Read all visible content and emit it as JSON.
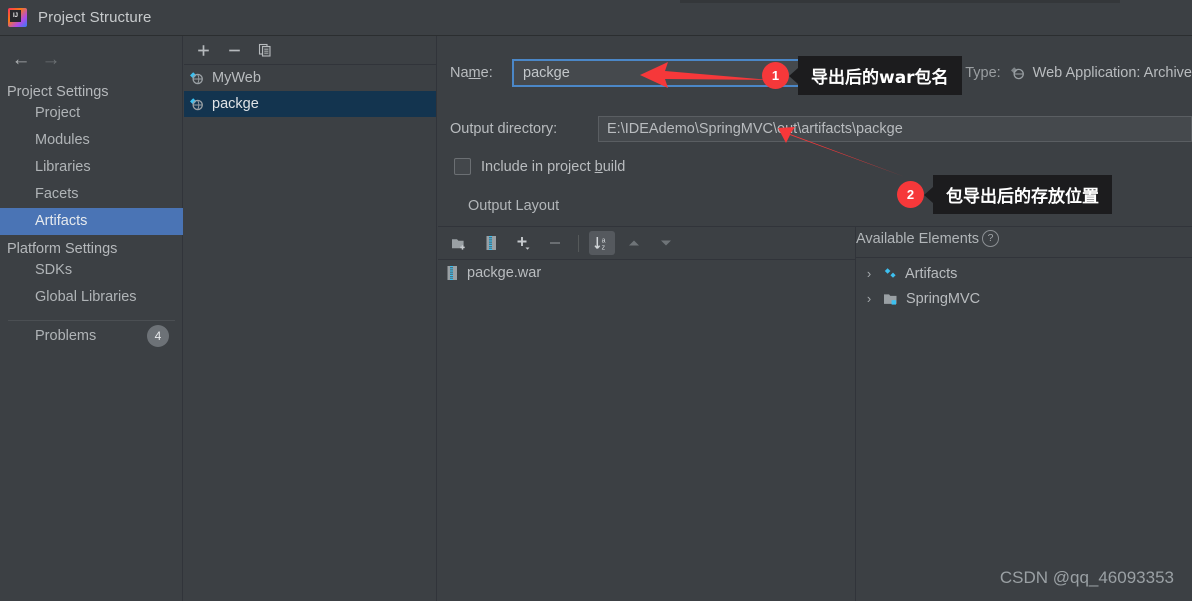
{
  "window": {
    "title": "Project Structure",
    "app_icon": "intellij-idea-logo"
  },
  "navigation": {
    "back_icon": "arrow-left-icon",
    "forward_icon": "arrow-right-icon"
  },
  "sidebar": {
    "groups": [
      {
        "label": "Project Settings",
        "items": [
          {
            "label": "Project",
            "selected": false
          },
          {
            "label": "Modules",
            "selected": false
          },
          {
            "label": "Libraries",
            "selected": false
          },
          {
            "label": "Facets",
            "selected": false
          },
          {
            "label": "Artifacts",
            "selected": true
          }
        ]
      },
      {
        "label": "Platform Settings",
        "items": [
          {
            "label": "SDKs",
            "selected": false
          },
          {
            "label": "Global Libraries",
            "selected": false
          }
        ]
      }
    ],
    "problems": {
      "label": "Problems",
      "count": "4"
    }
  },
  "artifacts_panel": {
    "toolbar": [
      {
        "name": "add-artifact-button",
        "glyph": "+"
      },
      {
        "name": "remove-artifact-button",
        "glyph": "−"
      },
      {
        "name": "copy-artifact-button",
        "glyph": "copy-icon"
      }
    ],
    "items": [
      {
        "label": "MyWeb",
        "selected": false,
        "icon": "artifact-icon"
      },
      {
        "label": "packge",
        "selected": true,
        "icon": "artifact-icon"
      }
    ]
  },
  "detail": {
    "name_label": "Name:",
    "name_label_prefix": "Na",
    "name_label_mnemonic": "m",
    "name_label_suffix": "e:",
    "name_value": "packge",
    "type_label": "Type:",
    "type_value": "Web Application: Archive",
    "output_directory_label": "Output directory:",
    "output_directory_value": "E:\\IDEAdemo\\SpringMVC\\out\\artifacts\\packge",
    "include_in_build": {
      "label_prefix": "Include in project ",
      "label_mnemonic": "b",
      "label_suffix": "uild",
      "checked": false
    },
    "output_layout_tab": "Output Layout"
  },
  "output_layout": {
    "toolbar": [
      {
        "name": "create-directory-button",
        "icon": "new-folder-icon",
        "state": "enabled"
      },
      {
        "name": "create-archive-button",
        "icon": "archive-icon",
        "state": "enabled"
      },
      {
        "name": "add-copy-of-button",
        "icon": "plus-dropdown-icon",
        "state": "enabled"
      },
      {
        "name": "remove-element-button",
        "icon": "minus-icon",
        "state": "disabled"
      },
      {
        "name": "sort-by-name-button",
        "icon": "sort-az-icon",
        "state": "active"
      },
      {
        "name": "move-up-button",
        "icon": "arrow-up-icon",
        "state": "disabled"
      },
      {
        "name": "move-down-button",
        "icon": "arrow-down-icon",
        "state": "disabled"
      }
    ],
    "items": [
      {
        "label": "packge.war",
        "icon": "archive-icon"
      }
    ]
  },
  "available_elements": {
    "title": "Available Elements",
    "help_icon": "question-mark-icon",
    "help_glyph": "?",
    "tree": [
      {
        "label": "Artifacts",
        "icon": "artifact-diamond-icon",
        "expanded": false,
        "chevron": "›"
      },
      {
        "label": "SpringMVC",
        "icon": "module-icon",
        "expanded": false,
        "chevron": "›"
      }
    ]
  },
  "annotations": {
    "marker_1": "1",
    "callout_1": "导出后的war包名",
    "marker_2": "2",
    "callout_2": "包导出后的存放位置",
    "accent_color": "#f6383a"
  },
  "watermark": "CSDN @qq_46093353"
}
